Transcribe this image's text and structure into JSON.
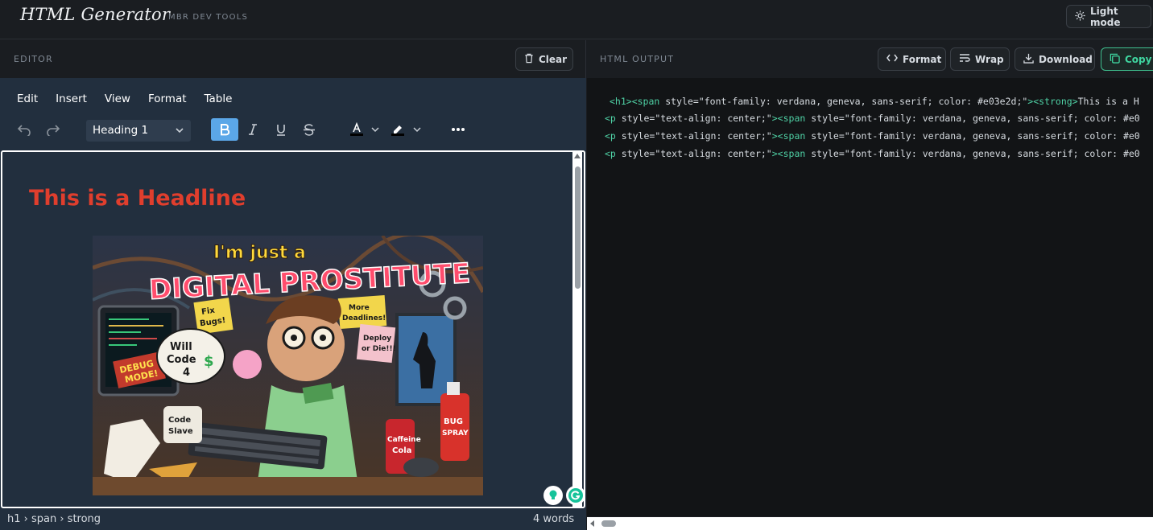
{
  "header": {
    "title": "HTML Generator",
    "subtitle": "MBR DEV TOOLS",
    "theme_toggle": "Light mode"
  },
  "editor": {
    "panel_title": "EDITOR",
    "clear_label": "Clear",
    "menu": [
      "Edit",
      "Insert",
      "View",
      "Format",
      "Table"
    ],
    "block_format": "Heading 1",
    "content": {
      "headline": "This is a Headline",
      "image_texts": {
        "top": "I'm just a",
        "main": "DIGITAL PROSTITUTE",
        "note1": "Fix Bugs!",
        "note2": "More Deadlines!",
        "note3": "Deploy or Die!!!",
        "bubble": "Will Code 4 $",
        "monitor": "DEBUG MODE!",
        "mug": "Code Slave",
        "can": "Caffeine Cola",
        "spray": "BUG SPRAY"
      }
    },
    "status_path": "h1 › span › strong",
    "word_count": "4 words",
    "colors": {
      "headline": "#e03e2d",
      "bg": "#222f3e",
      "bold_active": "#5ba7e8"
    }
  },
  "output": {
    "panel_title": "HTML OUTPUT",
    "buttons": {
      "format": "Format",
      "wrap": "Wrap",
      "download": "Download",
      "copy": "Copy"
    },
    "lines": [
      {
        "tag_open": "<h1>",
        "span_open": "<span",
        "attr": " style=\"font-family: verdana, geneva, sans-serif; color: #e03e2d;\"",
        "span_close": ">",
        "inner_open": "<strong>",
        "text": "This is a H"
      },
      {
        "p_open": "<p",
        "p_attr": " style=\"text-align: center;\"",
        "gt": ">",
        "span_open": "<span",
        "attr": " style=\"font-family: verdana, geneva, sans-serif; color: #e0"
      },
      {
        "p_open": "<p",
        "p_attr": " style=\"text-align: center;\"",
        "gt": ">",
        "span_open": "<span",
        "attr": " style=\"font-family: verdana, geneva, sans-serif; color: #e0"
      },
      {
        "p_open": "<p",
        "p_attr": " style=\"text-align: center;\"",
        "gt": ">",
        "span_open": "<span",
        "attr": " style=\"font-family: verdana, geneva, sans-serif; color: #e0"
      }
    ]
  }
}
